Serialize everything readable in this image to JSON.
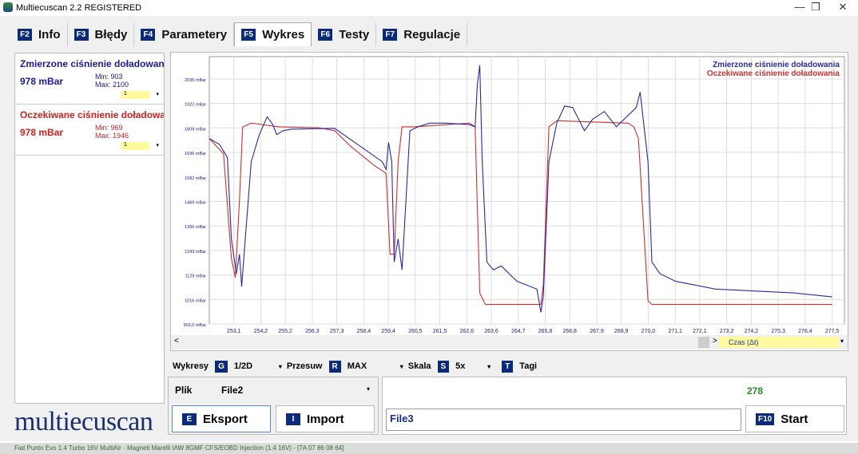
{
  "window": {
    "title": "Multiecuscan 2.2 REGISTERED",
    "controls": [
      "—",
      "❐",
      "✕"
    ]
  },
  "tabs": [
    {
      "key": "F2",
      "label": "Info"
    },
    {
      "key": "F3",
      "label": "Błędy"
    },
    {
      "key": "F4",
      "label": "Parametery"
    },
    {
      "key": "F5",
      "label": "Wykres",
      "active": true
    },
    {
      "key": "F6",
      "label": "Testy"
    },
    {
      "key": "F7",
      "label": "Regulacje"
    }
  ],
  "signals": [
    {
      "name": "Zmierzone ciśnienie doładowania",
      "value": "978 mBar",
      "min": "Min: 903",
      "max": "Max: 2100",
      "select": "1",
      "color": "#1a1a9a"
    },
    {
      "name": "Oczekiwane ciśnienie doładowania",
      "value": "978 mBar",
      "min": "Min: 969",
      "max": "Max: 1946",
      "select": "1",
      "color": "#cc2222"
    }
  ],
  "logo": "multiecuscan",
  "chart_data": {
    "type": "line",
    "ylabel_unit": "mBar",
    "ylim": [
      903,
      2100
    ],
    "xlim": [
      252.1,
      278.0
    ],
    "grid": true,
    "legend_placement": "top-right",
    "y_ticks": [
      "2035 mBar",
      "1922 mBar",
      "1809 mBar",
      "1696 mBar",
      "1582 mBar",
      "1469 mBar",
      "1356 mBar",
      "1243 mBar",
      "1129 mBar",
      "1016 mBar",
      "903,0 mBar"
    ],
    "y_tick_values": [
      2035,
      1922,
      1809,
      1696,
      1582,
      1469,
      1356,
      1243,
      1129,
      1016,
      903
    ],
    "x_ticks": [
      "253,1",
      "254,2",
      "255,2",
      "256,3",
      "257,3",
      "258,4",
      "259,4",
      "260,5",
      "261,5",
      "262,6",
      "263,6",
      "264,7",
      "265,8",
      "266,8",
      "267,9",
      "268,9",
      "270,0",
      "271,1",
      "272,1",
      "273,2",
      "274,2",
      "275,3",
      "276,4",
      "277,5"
    ],
    "series": [
      {
        "name": "Zmierzone ciśnienie doładowania",
        "color": "#2a2aa0",
        "x": [
          252.1,
          252.52,
          252.84,
          253.0,
          253.2,
          253.33,
          253.42,
          253.59,
          253.81,
          254.14,
          254.46,
          254.69,
          254.85,
          255.11,
          255.43,
          257.21,
          259.15,
          259.31,
          259.41,
          259.54,
          259.64,
          259.8,
          259.96,
          260.12,
          260.28,
          260.61,
          261.09,
          261.74,
          262.71,
          262.94,
          263.03,
          263.13,
          263.23,
          263.42,
          263.68,
          264.01,
          264.33,
          264.65,
          265.46,
          265.62,
          265.72,
          265.95,
          266.27,
          266.59,
          266.92,
          267.08,
          267.4,
          267.73,
          268.21,
          268.7,
          269.18,
          269.51,
          269.67,
          269.83,
          269.99,
          270.15,
          270.48,
          271.12,
          272.74,
          275.98,
          277.5
        ],
        "y": [
          1760,
          1732,
          1671,
          1296,
          1135,
          1225,
          1075,
          1332,
          1653,
          1778,
          1860,
          1824,
          1778,
          1796,
          1803,
          1807,
          1653,
          1617,
          1742,
          1653,
          1189,
          1296,
          1153,
          1475,
          1796,
          1814,
          1831,
          1831,
          1824,
          1814,
          2010,
          2099,
          1653,
          1189,
          1153,
          1171,
          1135,
          1100,
          1064,
          957,
          1028,
          1653,
          1831,
          1910,
          1903,
          1867,
          1796,
          1849,
          1885,
          1814,
          1867,
          1903,
          1974,
          1814,
          1653,
          1189,
          1135,
          1100,
          1064,
          1046,
          1028
        ]
      },
      {
        "name": "Oczekiwane ciśnienie doładowania",
        "color": "#d03030",
        "x": [
          252.1,
          252.68,
          253.0,
          253.16,
          253.33,
          253.46,
          253.81,
          254.94,
          256.56,
          257.21,
          257.86,
          258.83,
          259.31,
          259.47,
          259.64,
          259.8,
          259.96,
          260.45,
          262.71,
          262.94,
          263.13,
          263.36,
          265.62,
          265.72,
          265.95,
          266.27,
          269.18,
          269.41,
          269.6,
          269.99,
          270.15,
          277.5
        ],
        "y": [
          1760,
          1689,
          1207,
          1117,
          1475,
          1814,
          1831,
          1814,
          1810,
          1796,
          1724,
          1635,
          1599,
          1225,
          1225,
          1653,
          1814,
          1814,
          1831,
          1814,
          1046,
          993,
          993,
          1082,
          1814,
          1842,
          1831,
          1814,
          1760,
          1010,
          993,
          993
        ]
      }
    ]
  },
  "scroll": {
    "left_arrow": "<",
    "right_arrow": ">",
    "axis_select": "Czas (Δt)"
  },
  "controls": {
    "wykresy_label": "Wykresy",
    "wykresy_key": "G",
    "wykresy_value": "1/2D",
    "przesuw_label": "Przesuw",
    "przesuw_key": "R",
    "przesuw_value": "MAX",
    "skala_label": "Skala",
    "skala_key": "S",
    "skala_value": "5x",
    "tagi_key": "T",
    "tagi_label": "Tagi"
  },
  "file": {
    "label": "Plik",
    "value": "File2",
    "export_key": "E",
    "export_label": "Eksport",
    "import_key": "I",
    "import_label": "Import"
  },
  "run": {
    "counter": "278",
    "filename": "File3",
    "start_key": "F10",
    "start_label": "Start"
  },
  "status": "Fiat Punto Evo 1.4 Turbo 16V MultiAir - Magneti Marelli IAW 8GMF CFS/EOBD Injection (1.4 16V) - [7A 07 86 08 64]"
}
